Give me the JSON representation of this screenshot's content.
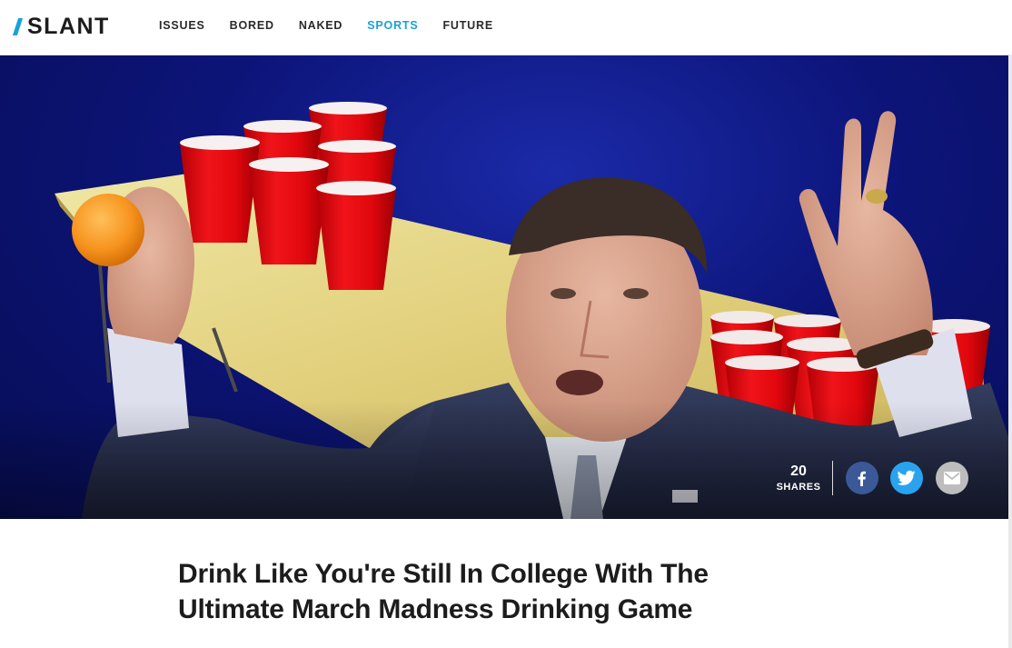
{
  "site": {
    "logo_text": "SLANT",
    "accent_color": "#1aa1d8"
  },
  "nav": {
    "items": [
      {
        "label": "ISSUES",
        "active": false
      },
      {
        "label": "BORED",
        "active": false
      },
      {
        "label": "NAKED",
        "active": false
      },
      {
        "label": "SPORTS",
        "active": true
      },
      {
        "label": "FUTURE",
        "active": false
      }
    ]
  },
  "hero": {
    "share_count": "20",
    "share_label": "SHARES",
    "share_buttons": [
      {
        "name": "facebook-icon",
        "color": "#3b5998"
      },
      {
        "name": "twitter-icon",
        "color": "#2aa3ef"
      },
      {
        "name": "mail-icon",
        "color": "#bdbdbd"
      }
    ]
  },
  "article": {
    "title_line1": "Drink Like You're Still In College With The",
    "title_line2": "Ultimate March Madness Drinking Game"
  }
}
